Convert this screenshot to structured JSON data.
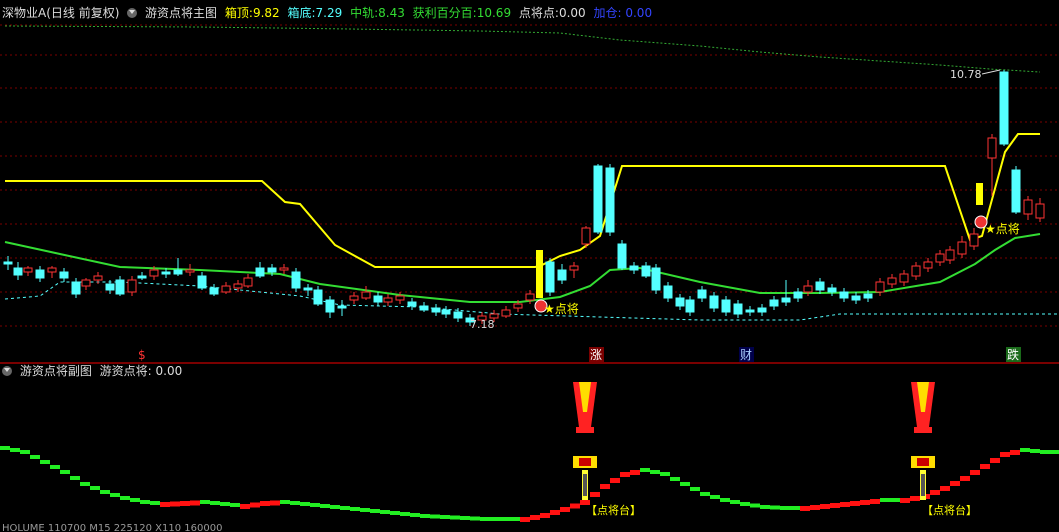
{
  "main_header": {
    "stock": "深物业A(日线 前复权)",
    "indicator": "游资点将主图",
    "box_top_label": "箱顶:",
    "box_top": "9.82",
    "box_bottom_label": "箱底:",
    "box_bottom": "7.29",
    "mid_label": "中轨:",
    "mid": "8.43",
    "profit_label": "获利百分百:",
    "profit": "10.69",
    "dianjiang_label": "点将点:",
    "dianjiang": "0.00",
    "jiacang": "加仓: 0.00"
  },
  "sub_header": {
    "indicator": "游资点将副图",
    "value": "游资点将: 0.00"
  },
  "bottom_text": "HOLUME 110700  M15 225120  X110 160000",
  "annotations": {
    "high_price": "10.78",
    "low_price": "7.18",
    "marker_1": "★点将",
    "marker_2": "★点将",
    "platform_label": "【点将台】"
  },
  "event_labels": [
    "$",
    "涨",
    "财",
    "跌"
  ],
  "colors": {
    "up": "#ff3333",
    "down": "#54ffff",
    "yellow": "#ffff00",
    "green": "#33dd33",
    "grid": "#7a0000"
  },
  "chart_data": {
    "type": "candlestick",
    "ylim": [
      7.0,
      11.2
    ],
    "series": [
      {
        "name": "箱顶",
        "values": []
      },
      {
        "name": "中轨",
        "values": []
      }
    ]
  }
}
